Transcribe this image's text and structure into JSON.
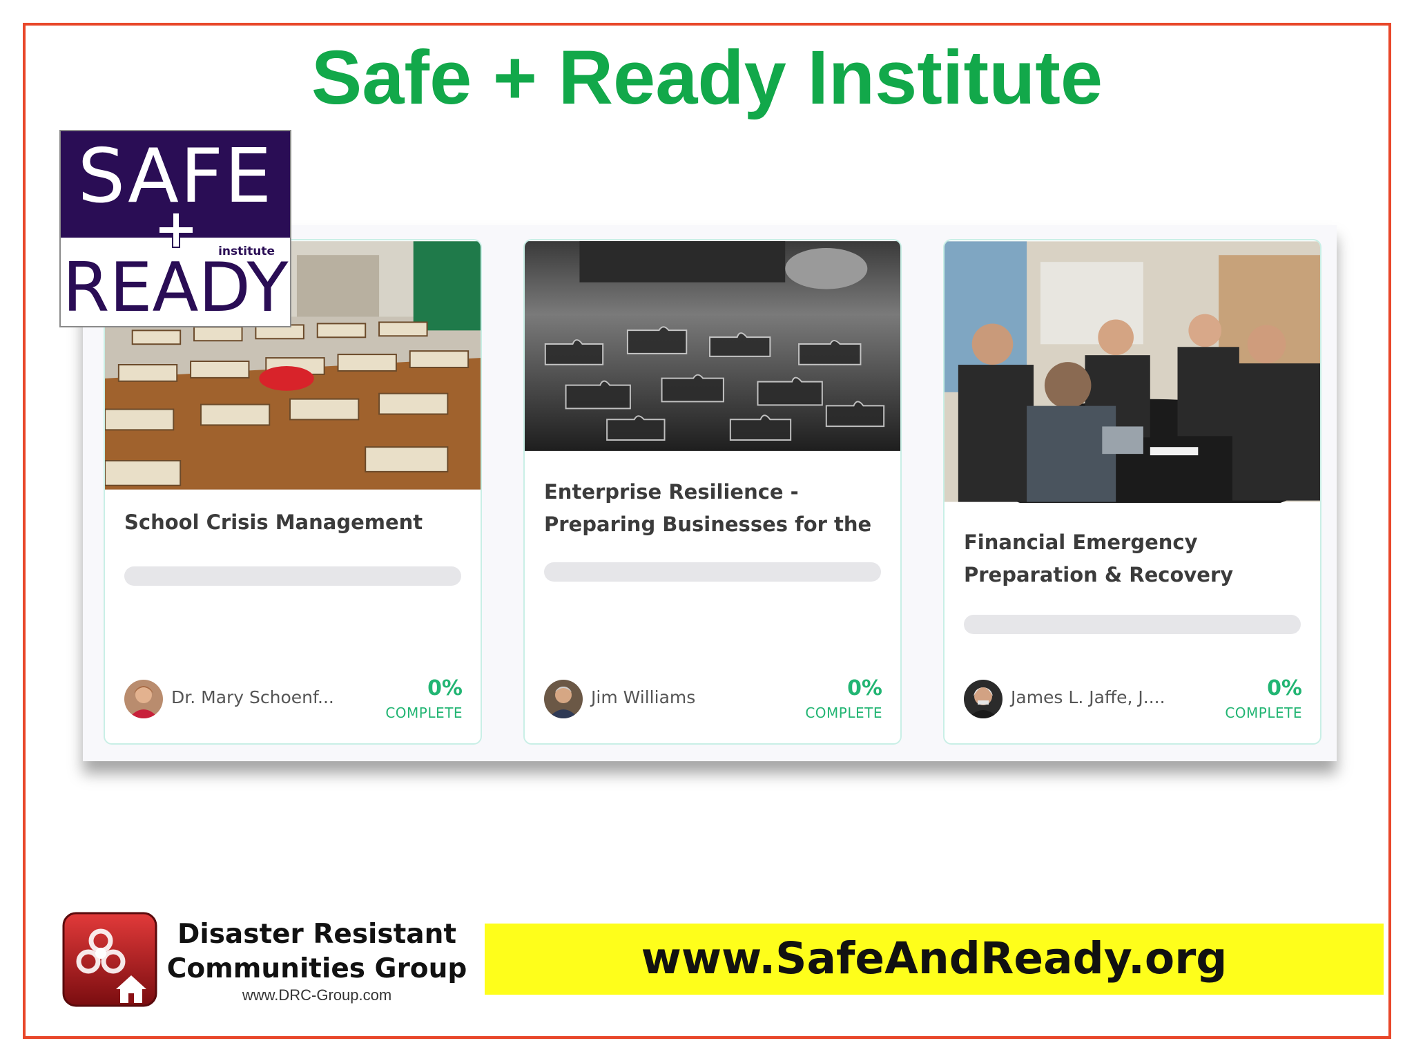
{
  "title": "Safe + Ready Institute",
  "logo": {
    "top_word": "SAFE",
    "small_word": "institute",
    "bottom_word": "READY"
  },
  "courses": [
    {
      "title": "School Crisis Management",
      "author": "Dr. Mary Schoenf...",
      "percent": "0%",
      "complete_label": "COMPLETE",
      "progress": 0
    },
    {
      "title": "Enterprise Resilience - Preparing Businesses for the",
      "author": "Jim Williams",
      "percent": "0%",
      "complete_label": "COMPLETE",
      "progress": 0
    },
    {
      "title": "Financial Emergency Preparation & Recovery",
      "author": "James L. Jaffe, J....",
      "percent": "0%",
      "complete_label": "COMPLETE",
      "progress": 0
    }
  ],
  "footer": {
    "org_line1": "Disaster Resistant",
    "org_line2": "Communities Group",
    "org_url": "www.DRC-Group.com",
    "banner_url": "www.SafeAndReady.org"
  },
  "colors": {
    "title_green": "#12a84a",
    "frame_red": "#e8472a",
    "logo_purple": "#2a0d55",
    "banner_yellow": "#fefe1b",
    "complete_green": "#22b573"
  }
}
